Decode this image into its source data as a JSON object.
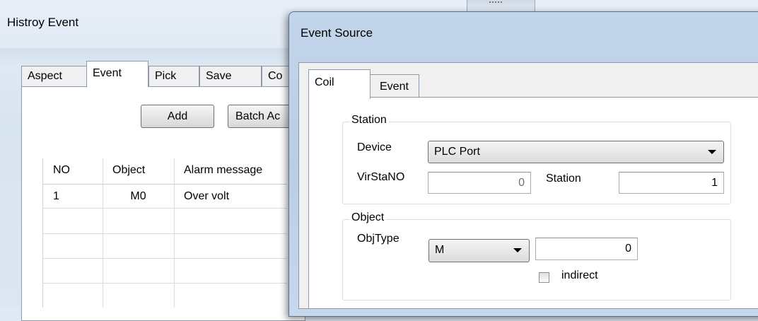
{
  "history_window": {
    "title": "Histroy Event",
    "tabs": [
      "Aspect",
      "Event",
      "Pick",
      "Save",
      "Co"
    ],
    "add_button": "Add",
    "batch_add_button": "Batch Ac",
    "grid": {
      "columns": [
        "NO",
        "Object",
        "Alarm message"
      ],
      "rows": [
        {
          "no": "1",
          "object": "M0",
          "message": "Over volt"
        }
      ]
    }
  },
  "event_source_dialog": {
    "title": "Event Source",
    "tabs": [
      "Coil",
      "Event"
    ],
    "station_group": {
      "label": "Station",
      "device_label": "Device",
      "device_value": "PLC Port",
      "virstano_label": "VirStaNO",
      "virstano_value": "0",
      "station_label": "Station",
      "station_value": "1"
    },
    "object_group": {
      "label": "Object",
      "objtype_label": "ObjType",
      "objtype_value": "M",
      "address_value": "0",
      "indirect_label": "indirect",
      "indirect_checked": false
    }
  }
}
